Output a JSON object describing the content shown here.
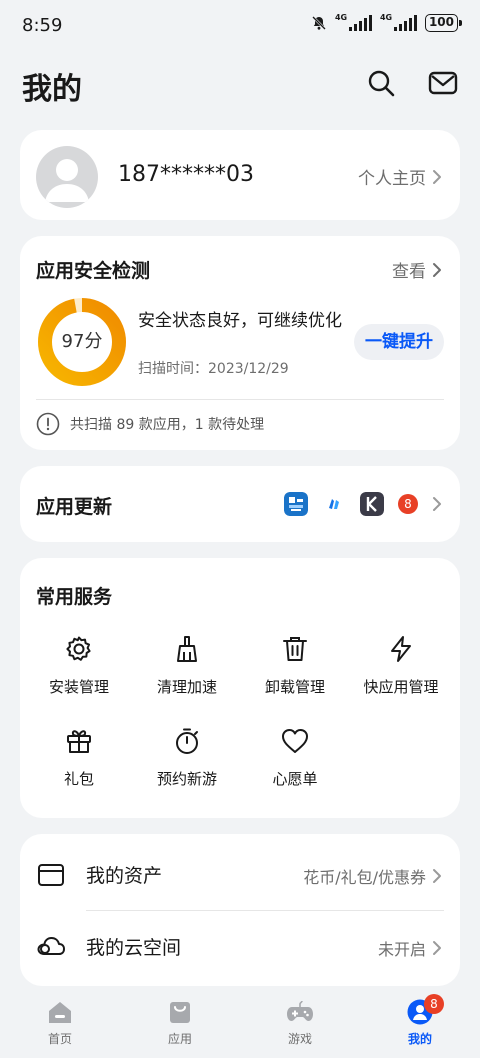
{
  "status_bar": {
    "time": "8:59",
    "net1": "4G",
    "net2": "4G",
    "battery": "100"
  },
  "header": {
    "title": "我的",
    "search_icon": "search-icon",
    "mail_icon": "mail-icon"
  },
  "profile": {
    "username": "187******03",
    "homepage_label": "个人主页"
  },
  "security": {
    "title": "应用安全检测",
    "view_label": "查看",
    "score": "97分",
    "score_value": 97,
    "status_text": "安全状态良好，可继续优化",
    "scan_time": "扫描时间：2023/12/29",
    "boost_label": "一键提升",
    "scan_summary": "共扫描 89 款应用，1 款待处理",
    "colors": {
      "ring_start": "#f7b500",
      "ring_end": "#f08c00",
      "ring_track": "#fdeccc"
    }
  },
  "app_update": {
    "title": "应用更新",
    "badge": "8"
  },
  "services": {
    "title": "常用服务",
    "items": [
      {
        "label": "安装管理",
        "icon": "gear-icon"
      },
      {
        "label": "清理加速",
        "icon": "broom-icon"
      },
      {
        "label": "卸载管理",
        "icon": "trash-icon"
      },
      {
        "label": "快应用管理",
        "icon": "bolt-icon"
      },
      {
        "label": "礼包",
        "icon": "gift-icon"
      },
      {
        "label": "预约新游",
        "icon": "stopwatch-icon"
      },
      {
        "label": "心愿单",
        "icon": "heart-icon"
      }
    ]
  },
  "assets": {
    "my_assets_label": "我的资产",
    "my_assets_value": "花币/礼包/优惠券",
    "cloud_label": "我的云空间",
    "cloud_value": "未开启"
  },
  "tabbar": {
    "items": [
      {
        "label": "首页",
        "icon": "home-icon"
      },
      {
        "label": "应用",
        "icon": "apps-bag-icon"
      },
      {
        "label": "游戏",
        "icon": "gamepad-icon"
      },
      {
        "label": "我的",
        "icon": "profile-icon"
      }
    ],
    "active_index": 3,
    "mine_badge": "8"
  },
  "colors": {
    "accent": "#0a59f7",
    "badge": "#e84026",
    "background": "#f1f3f5"
  }
}
